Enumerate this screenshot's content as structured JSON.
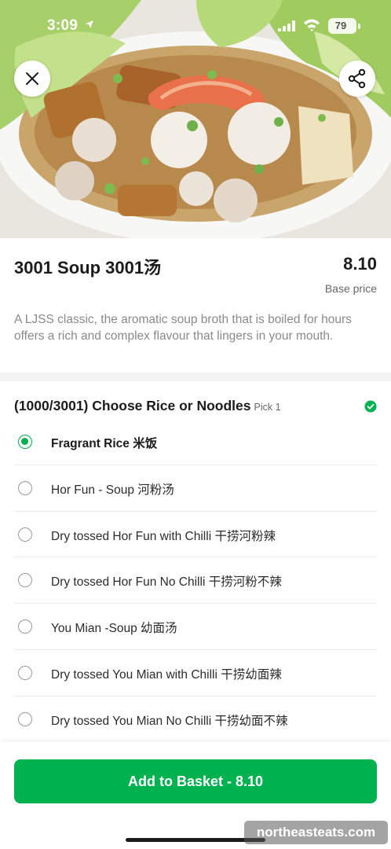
{
  "status_bar": {
    "time": "3:09",
    "battery": "79"
  },
  "header": {
    "close_icon": "close-icon",
    "share_icon": "share-icon",
    "hero_image": "bowl of soup with prawn, fish balls and lettuce"
  },
  "item": {
    "title": "3001 Soup 3001汤",
    "price": "8.10",
    "price_caption": "Base price",
    "description": "A LJSS classic, the aromatic soup broth that is boiled for hours offers a rich and complex flavour that lingers in your mouth."
  },
  "option_group": {
    "title": "(1000/3001) Choose Rice or Noodles",
    "pick": "Pick 1",
    "options": [
      {
        "label": "Fragrant Rice 米饭",
        "selected": true
      },
      {
        "label": "Hor Fun - Soup 河粉汤",
        "selected": false
      },
      {
        "label": "Dry tossed Hor Fun with Chilli 干捞河粉辣",
        "selected": false
      },
      {
        "label": "Dry tossed Hor Fun No Chilli 干捞河粉不辣",
        "selected": false
      },
      {
        "label": "You Mian -Soup 幼面汤",
        "selected": false
      },
      {
        "label": "Dry tossed You Mian with Chilli 干捞幼面辣",
        "selected": false
      },
      {
        "label": "Dry tossed You Mian  No Chilli 干捞幼面不辣",
        "selected": false
      }
    ]
  },
  "footer": {
    "add_button_label": "Add to Basket - 8.10"
  },
  "watermark": "northeasteats.com",
  "colors": {
    "accent": "#00b14f",
    "text": "#1c1c1c",
    "muted": "#8a8a8a"
  }
}
